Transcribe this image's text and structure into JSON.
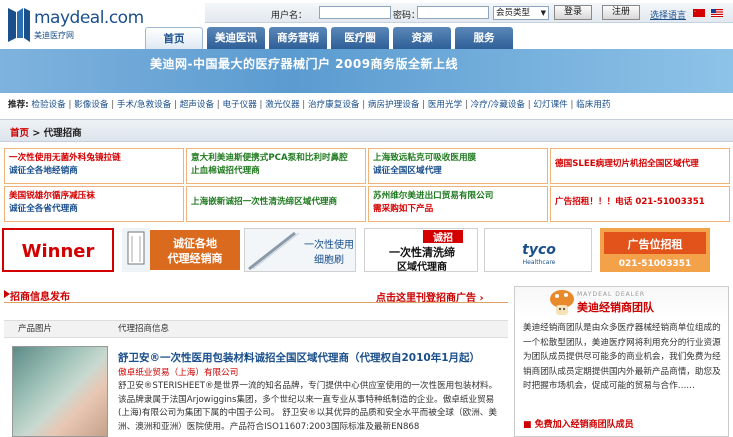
{
  "logo": {
    "text": "maydeal.com",
    "sub": "美迪医疗网"
  },
  "login": {
    "username_label": "用户名：",
    "password_label": "密码：",
    "member_type": "会员类型",
    "login_btn": "登录",
    "register_btn": "注册",
    "lang_link": "选择语言"
  },
  "nav": {
    "tabs": [
      "首页",
      "美迪医讯",
      "商务营销",
      "医疗圈",
      "资源",
      "服务"
    ]
  },
  "banner": {
    "text": "美迪网-中国最大的医疗器械门户  2009商务版全新上线"
  },
  "recommend": {
    "label": "推荐:",
    "items": [
      "检验设备",
      "影像设备",
      "手术/急救设备",
      "超声设备",
      "电子仪器",
      "激光仪器",
      "治疗康复设备",
      "病房护理设备",
      "医用光学",
      "冷疗/冷藏设备",
      "幻灯课件",
      "临床用药"
    ]
  },
  "breadcrumb": {
    "home": "首页",
    "current": "> 代理招商"
  },
  "ads": [
    {
      "line1": "一次性使用无菌外科兔镜拉链",
      "line2": "诚征全各地经销商"
    },
    {
      "line1": "意大利美迪斯便携式PCA泵和比利时鼻腔",
      "line2": "止血棉诚招代理商"
    },
    {
      "line1": "上海致远粘克可吸收医用膜",
      "line2": "诚征全国区域代理"
    },
    {
      "line1": "德国SLEE病理切片机招全国区域代理",
      "line2": ""
    },
    {
      "line1": "美国锐雄尔循序减压袜",
      "line2": "诚征全各省代理商"
    },
    {
      "line1": "上海嵌新诚招一次性清洗缔区域代理商",
      "line2": ""
    },
    {
      "line1": "苏州维尔美进出口贸易有限公司",
      "line2": "需采购如下产品"
    },
    {
      "line1": "广告招租！！！电话  021-51003351",
      "line2": ""
    }
  ],
  "logo_banners": {
    "winner": "Winner",
    "agent": {
      "l1": "诚征各地",
      "l2": "代理经销商"
    },
    "brush": {
      "l1": "一次性使用",
      "l2": "细胞刷"
    },
    "recruit": {
      "l1": "诚招",
      "l2": "一次性清洗缔",
      "l3": "区域代理商"
    },
    "tyco": {
      "name": "tyco",
      "sub": "Healthcare"
    },
    "adrent": {
      "l1": "广告位招租",
      "l2": "021-51003351"
    }
  },
  "section": {
    "title": "招商信息发布",
    "link": "点击这里刊登招商广告 ›"
  },
  "list": {
    "col1": "产品图片",
    "col2": "代理招商信息"
  },
  "item": {
    "title": "舒卫安®一次性医用包装材料诚招全国区域代理商（代理权自2010年1月起）",
    "company": "傲卓纸业贸易（上海）有限公司",
    "desc": "舒卫安®STERISHEET®是世界一流的知名品牌，专门提供中心供应室使用的一次性医用包装材料。该品牌隶属于法国Arjowiggins集团，多个世纪以来一直专业从事特种纸制造的企业。傲卓纸业贸易(上海)有限公司为集团下属的中国子公司。  舒卫安®以其优异的品质和安全水平而被全球（欧洲、美洲、澳洲和亚洲）医院使用。产品符合ISO11607:2003国际标准及最新EN868"
  },
  "sidebar": {
    "sub": "MAYDEAL DEALER",
    "title": "美迪经销商团队",
    "text": "美迪经销商团队是由众多医疗器械经销商单位组成的一个松散型团队，美迪医疗网将利用充分的行业资源为团队成员提供尽可能多的商业机会，我们免费为经销商团队成员定期提供国内外最新产品商情，助您及时把握市场机会，促成可能的贸易与合作……",
    "join": "■  免费加入经销商团队成员"
  }
}
